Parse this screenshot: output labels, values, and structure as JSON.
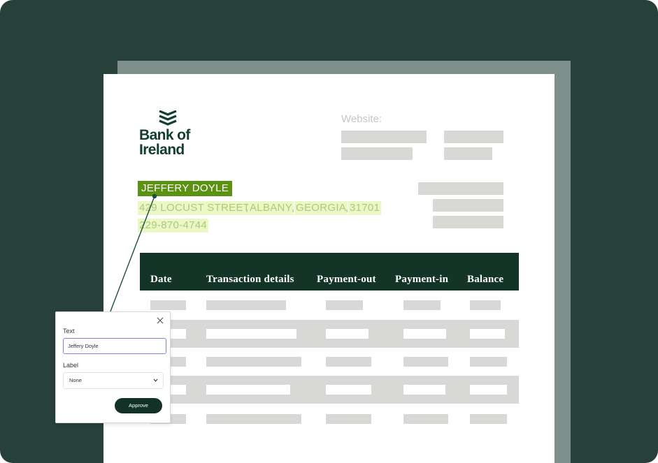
{
  "document": {
    "bank_name_line1": "Bank of",
    "bank_name_line2": "Ireland",
    "website_label": "Website:",
    "customer": {
      "name": "JEFFERY DOYLE",
      "street": "429 LOCUST STREET",
      "city": "ALBANY",
      "state": "GEORGIA",
      "zip": "31701",
      "phone": "229-870-4744",
      "separator_comma": ","
    },
    "table": {
      "columns": [
        "Date",
        "Transaction details",
        "Payment-out",
        "Payment-in",
        "Balance"
      ]
    }
  },
  "panel": {
    "text_label": "Text",
    "text_value": "Jeffery Doyle",
    "label_label": "Label",
    "label_value": "None",
    "approve_label": "Approve"
  },
  "colors": {
    "background": "#27413a",
    "brand_green": "#123d30",
    "highlight_strong": "#5b9211",
    "highlight_soft": "#ecf7c8",
    "table_header": "#143428",
    "input_focus": "#7d84e0"
  },
  "icons": {
    "logo": "bank-chevrons-icon",
    "close": "close-icon",
    "dropdown": "chevron-down-icon"
  }
}
